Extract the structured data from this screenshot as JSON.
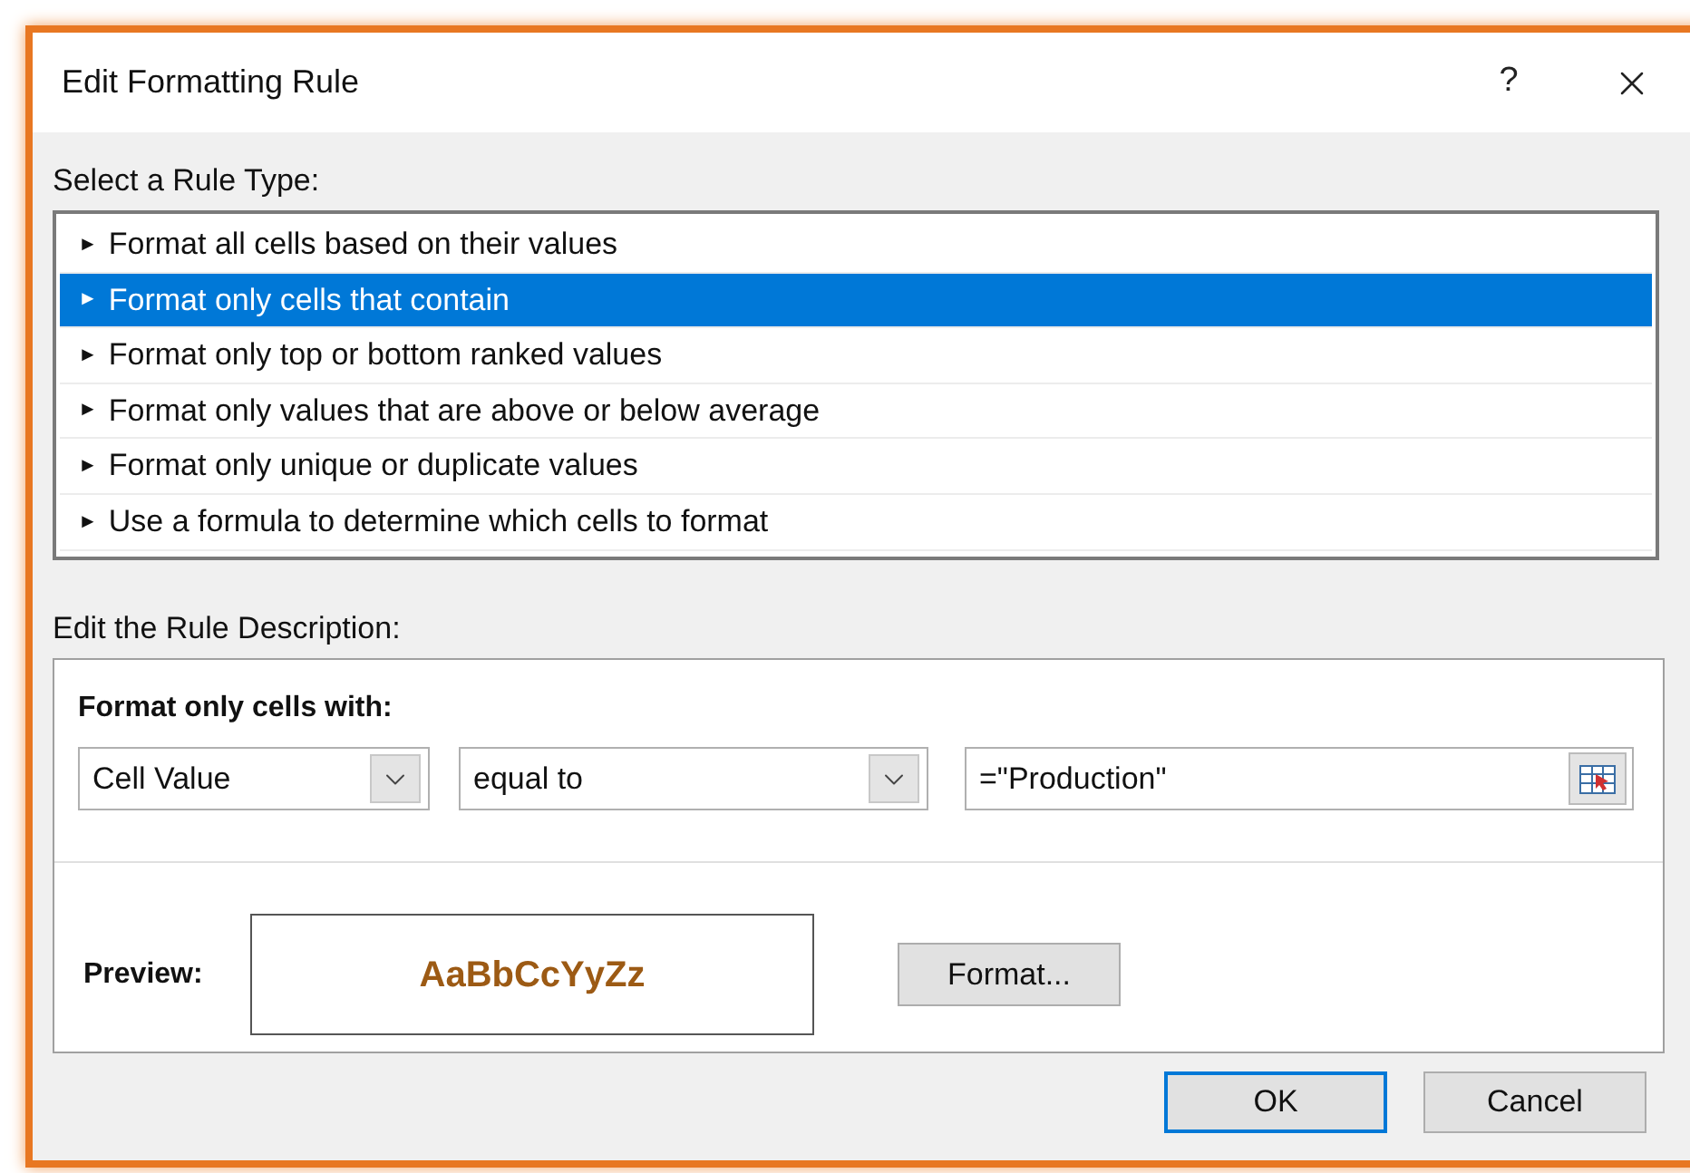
{
  "window": {
    "title": "Edit Formatting Rule",
    "help": "?"
  },
  "rule_types": {
    "label": "Select a Rule Type:",
    "marker": "►",
    "items": [
      {
        "label": "Format all cells based on their values",
        "selected": false
      },
      {
        "label": "Format only cells that contain",
        "selected": true
      },
      {
        "label": "Format only top or bottom ranked values",
        "selected": false
      },
      {
        "label": "Format only values that are above or below average",
        "selected": false
      },
      {
        "label": "Format only unique or duplicate values",
        "selected": false
      },
      {
        "label": "Use a formula to determine which cells to format",
        "selected": false
      }
    ]
  },
  "description": {
    "label": "Edit the Rule Description:",
    "heading": "Format only cells with:",
    "condition": {
      "operand": "Cell Value",
      "operator": "equal to",
      "value": "=\"Production\""
    },
    "preview": {
      "label": "Preview:",
      "sample": "AaBbCcYyZz",
      "color": "#9c5a14"
    },
    "format_button": "Format..."
  },
  "buttons": [
    {
      "label": "OK",
      "default": true
    },
    {
      "label": "Cancel",
      "default": false
    }
  ]
}
